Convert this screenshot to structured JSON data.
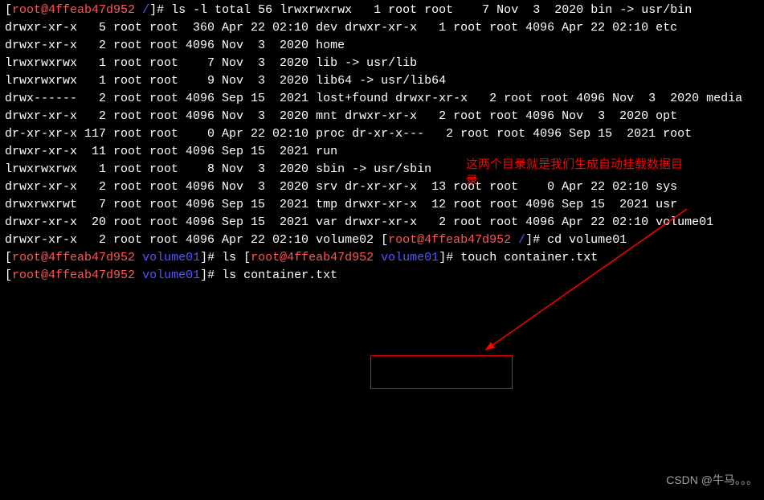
{
  "prompt1": {
    "user": "root@4ffeab47d952",
    "path": "/",
    "cmd": "ls -l"
  },
  "total": "total 56",
  "rows": [
    {
      "perm": "lrwxrwxrwx",
      "n": "  1",
      "own": "root root",
      "size": "   7",
      "date": "Nov  3  2020",
      "name": "bin -> usr/bin"
    },
    {
      "perm": "drwxr-xr-x",
      "n": "  5",
      "own": "root root",
      "size": " 360",
      "date": "Apr 22 02:10",
      "name": "dev"
    },
    {
      "perm": "drwxr-xr-x",
      "n": "  1",
      "own": "root root",
      "size": "4096",
      "date": "Apr 22 02:10",
      "name": "etc"
    },
    {
      "perm": "drwxr-xr-x",
      "n": "  2",
      "own": "root root",
      "size": "4096",
      "date": "Nov  3  2020",
      "name": "home"
    },
    {
      "perm": "lrwxrwxrwx",
      "n": "  1",
      "own": "root root",
      "size": "   7",
      "date": "Nov  3  2020",
      "name": "lib -> usr/lib"
    },
    {
      "perm": "lrwxrwxrwx",
      "n": "  1",
      "own": "root root",
      "size": "   9",
      "date": "Nov  3  2020",
      "name": "lib64 -> usr/lib64"
    },
    {
      "perm": "drwx------",
      "n": "  2",
      "own": "root root",
      "size": "4096",
      "date": "Sep 15  2021",
      "name": "lost+found"
    },
    {
      "perm": "drwxr-xr-x",
      "n": "  2",
      "own": "root root",
      "size": "4096",
      "date": "Nov  3  2020",
      "name": "media"
    },
    {
      "perm": "drwxr-xr-x",
      "n": "  2",
      "own": "root root",
      "size": "4096",
      "date": "Nov  3  2020",
      "name": "mnt"
    },
    {
      "perm": "drwxr-xr-x",
      "n": "  2",
      "own": "root root",
      "size": "4096",
      "date": "Nov  3  2020",
      "name": "opt"
    },
    {
      "perm": "dr-xr-xr-x",
      "n": "117",
      "own": "root root",
      "size": "   0",
      "date": "Apr 22 02:10",
      "name": "proc"
    },
    {
      "perm": "dr-xr-x---",
      "n": "  2",
      "own": "root root",
      "size": "4096",
      "date": "Sep 15  2021",
      "name": "root"
    },
    {
      "perm": "drwxr-xr-x",
      "n": " 11",
      "own": "root root",
      "size": "4096",
      "date": "Sep 15  2021",
      "name": "run"
    },
    {
      "perm": "lrwxrwxrwx",
      "n": "  1",
      "own": "root root",
      "size": "   8",
      "date": "Nov  3  2020",
      "name": "sbin -> usr/sbin"
    },
    {
      "perm": "drwxr-xr-x",
      "n": "  2",
      "own": "root root",
      "size": "4096",
      "date": "Nov  3  2020",
      "name": "srv"
    },
    {
      "perm": "dr-xr-xr-x",
      "n": " 13",
      "own": "root root",
      "size": "   0",
      "date": "Apr 22 02:10",
      "name": "sys"
    },
    {
      "perm": "drwxrwxrwt",
      "n": "  7",
      "own": "root root",
      "size": "4096",
      "date": "Sep 15  2021",
      "name": "tmp"
    },
    {
      "perm": "drwxr-xr-x",
      "n": " 12",
      "own": "root root",
      "size": "4096",
      "date": "Sep 15  2021",
      "name": "usr"
    },
    {
      "perm": "drwxr-xr-x",
      "n": " 20",
      "own": "root root",
      "size": "4096",
      "date": "Sep 15  2021",
      "name": "var"
    },
    {
      "perm": "drwxr-xr-x",
      "n": "  2",
      "own": "root root",
      "size": "4096",
      "date": "Apr 22 02:10",
      "name": "volume01"
    },
    {
      "perm": "drwxr-xr-x",
      "n": "  2",
      "own": "root root",
      "size": "4096",
      "date": "Apr 22 02:10",
      "name": "volume02"
    }
  ],
  "prompt2": {
    "user": "root@4ffeab47d952",
    "path": "/",
    "cmd": "cd volume01"
  },
  "prompt3": {
    "user": "root@4ffeab47d952",
    "path": "volume01",
    "cmd": "ls"
  },
  "prompt4": {
    "user": "root@4ffeab47d952",
    "path": "volume01",
    "cmd": "touch container.txt"
  },
  "prompt5": {
    "user": "root@4ffeab47d952",
    "path": "volume01",
    "cmd": "ls"
  },
  "output_file": "container.txt",
  "annotation": "这两个目录就是我们生成自动挂载数据目\n录",
  "watermark": "CSDN @牛马。。。"
}
